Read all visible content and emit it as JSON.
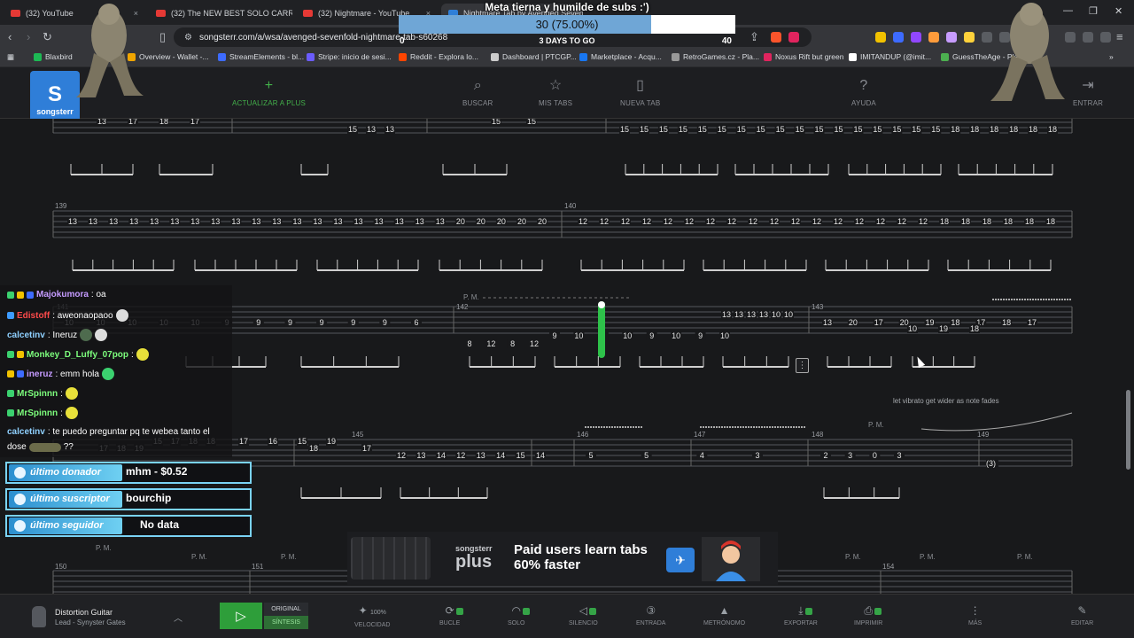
{
  "browser": {
    "tabs": [
      {
        "title": "(32) YouTube",
        "close": "×"
      },
      {
        "title": "(32) The NEW BEST SOLO CARRY CH...",
        "close": "×"
      },
      {
        "title": "(32) Nightmare - YouTube",
        "close": "×"
      },
      {
        "title": "Nightmare Tab by Avenged Seven...",
        "close": "×"
      }
    ],
    "url": "songsterr.com/a/wsa/avenged-sevenfold-nightmare-tab-s60268",
    "bookmarks": [
      {
        "label": "Blaxbird",
        "color": "#1db954"
      },
      {
        "label": "Overview - Wallet -...",
        "color": "#f0a500"
      },
      {
        "label": "StreamElements - bl...",
        "color": "#3d6bff"
      },
      {
        "label": "Stripe: inicio de sesi...",
        "color": "#6b5cff"
      },
      {
        "label": "Reddit - Explora lo...",
        "color": "#ff4500"
      },
      {
        "label": "Dashboard | PTCGP...",
        "color": "#cccccc"
      },
      {
        "label": "Marketplace - Acqu...",
        "color": "#1877f2"
      },
      {
        "label": "RetroGames.cz - Pla...",
        "color": "#999999"
      },
      {
        "label": "Noxus Rift but green",
        "color": "#e0245e"
      },
      {
        "label": "IMITANDUP (@imit...",
        "color": "#ffffff"
      },
      {
        "label": "GuessTheAge - Play...",
        "color": "#4caf50"
      }
    ]
  },
  "header": {
    "logo_text": "songsterr",
    "items": [
      {
        "label": "ACTUALIZAR A PLUS",
        "icon": "plus-icon",
        "glyph": "+"
      },
      {
        "label": "BUSCAR",
        "icon": "search-icon",
        "glyph": "⌕"
      },
      {
        "label": "MIS TABS",
        "icon": "star-icon",
        "glyph": "☆"
      },
      {
        "label": "NUEVA TAB",
        "icon": "new-document-icon",
        "glyph": "▯"
      },
      {
        "label": "AYUDA",
        "icon": "help-icon",
        "glyph": "?"
      },
      {
        "label": "ENTRAR",
        "icon": "login-icon",
        "glyph": "⇥"
      }
    ]
  },
  "goal": {
    "title": "Meta tierna y humilde de subs :')",
    "percent_text": "30 (75.00%)",
    "progress": 0.75,
    "days_text": "3 DAYS TO GO",
    "min": "0",
    "max": "40"
  },
  "chat": [
    {
      "user": "Majokumora",
      "text": ": oa",
      "color": "#c59bff"
    },
    {
      "user": "Edistoff",
      "text": ": aweonaopaoo",
      "color": "#ff4b4b"
    },
    {
      "user": "calcetinv",
      "text": ": Ineruz",
      "color": "#8fd0ff"
    },
    {
      "user": "Monkey_D_Luffy_07pop",
      "text": ":",
      "color": "#7dff7d"
    },
    {
      "user": "ineruz",
      "text": ": emm hola",
      "color": "#c59bff"
    },
    {
      "user": "MrSpinnn",
      "text": ":",
      "color": "#7dff7d"
    },
    {
      "user": "MrSpinnn",
      "text": ":",
      "color": "#7dff7d"
    },
    {
      "user": "calcetinv",
      "text": ": te puedo preguntar pq te webea tanto el",
      "color": "#8fd0ff"
    },
    {
      "user": "",
      "text": "dose",
      "color": "#ffffff"
    },
    {
      "user": "",
      "text": "??",
      "color": "#ffffff"
    }
  ],
  "alerts": [
    {
      "label": "último donador",
      "value": "mhm - $0.52"
    },
    {
      "label": "último suscriptor",
      "value": "bourchip"
    },
    {
      "label": "último seguidor",
      "value": "No data"
    }
  ],
  "score": {
    "row1": {
      "numbers": [
        "13",
        "17",
        "18",
        "17",
        "15",
        "13",
        "13",
        "15",
        "15",
        "15",
        "15",
        "15",
        "15",
        "15",
        "15",
        "15",
        "15",
        "15",
        "15",
        "15",
        "15",
        "15",
        "15",
        "15",
        "15",
        "15",
        "18",
        "18",
        "18",
        "18",
        "18",
        "18"
      ]
    },
    "row2": {
      "measures": [
        "139",
        "140"
      ],
      "numbers": [
        "13",
        "13",
        "13",
        "13",
        "13",
        "13",
        "13",
        "13",
        "13",
        "13",
        "13",
        "13",
        "13",
        "13",
        "13",
        "13",
        "13",
        "13",
        "13",
        "20",
        "20",
        "20",
        "20",
        "20",
        "12",
        "12",
        "12",
        "12",
        "12",
        "12",
        "12",
        "12",
        "12",
        "12",
        "12",
        "12",
        "12",
        "12",
        "12",
        "12",
        "12",
        "18",
        "18",
        "18",
        "18",
        "18",
        "18"
      ]
    },
    "row3": {
      "measures": [
        "141",
        "142",
        "143"
      ],
      "pm": "P. M.",
      "top": [
        "10",
        "10",
        "10",
        "10",
        "10",
        "9",
        "9",
        "9",
        "9",
        "9",
        "9",
        "6",
        "13",
        "13",
        "13",
        "13",
        "10",
        "10",
        "13",
        "20",
        "17",
        "20",
        "19",
        "18",
        "17",
        "18",
        "17"
      ],
      "low": [
        "8",
        "12",
        "8",
        "12",
        "9",
        "10",
        "9",
        "10",
        "9",
        "10",
        "9",
        "10",
        "10",
        "19",
        "18"
      ]
    },
    "row4": {
      "measures": [
        "145",
        "146",
        "147",
        "148",
        "149"
      ],
      "note": "let vibrato get wider as note fades",
      "pm": "P. M.",
      "numbers": [
        "15",
        "17",
        "18",
        "18",
        "17",
        "16",
        "15",
        "19",
        "18",
        "17",
        "12",
        "13",
        "14",
        "12",
        "13",
        "14",
        "15",
        "14",
        "5",
        "5",
        "4",
        "3",
        "2",
        "3",
        "0",
        "3",
        "(3)",
        "17",
        "18",
        "19"
      ]
    },
    "row5": {
      "measures": [
        "150",
        "151",
        "154"
      ],
      "pm": "P. M."
    }
  },
  "ad": {
    "brand_top": "songsterr",
    "brand_bottom": "plus",
    "line1": "Paid users learn tabs",
    "line2": "60% faster"
  },
  "player": {
    "track_name": "Distortion Guitar",
    "track_sub": "Lead - Synyster Gates",
    "mode_original": "ORIGINAL",
    "mode_synth": "SÍNTESIS",
    "speed_value": "100%",
    "items": [
      {
        "label": "VELOCIDAD",
        "icon": "speed-icon",
        "glyph": "✦"
      },
      {
        "label": "BUCLE",
        "icon": "loop-icon",
        "glyph": "⟳"
      },
      {
        "label": "SOLO",
        "icon": "headphones-icon",
        "glyph": "◠"
      },
      {
        "label": "SILENCIO",
        "icon": "mute-icon",
        "glyph": "◁"
      },
      {
        "label": "ENTRADA",
        "icon": "count-in-icon",
        "glyph": "③"
      },
      {
        "label": "METRÓNOMO",
        "icon": "metronome-icon",
        "glyph": "▲"
      },
      {
        "label": "EXPORTAR",
        "icon": "export-icon",
        "glyph": "⤓"
      },
      {
        "label": "IMPRIMIR",
        "icon": "print-icon",
        "glyph": "⎙"
      },
      {
        "label": "MÁS",
        "icon": "more-icon",
        "glyph": "⋮"
      },
      {
        "label": "EDITAR",
        "icon": "edit-icon",
        "glyph": "✎"
      }
    ]
  }
}
